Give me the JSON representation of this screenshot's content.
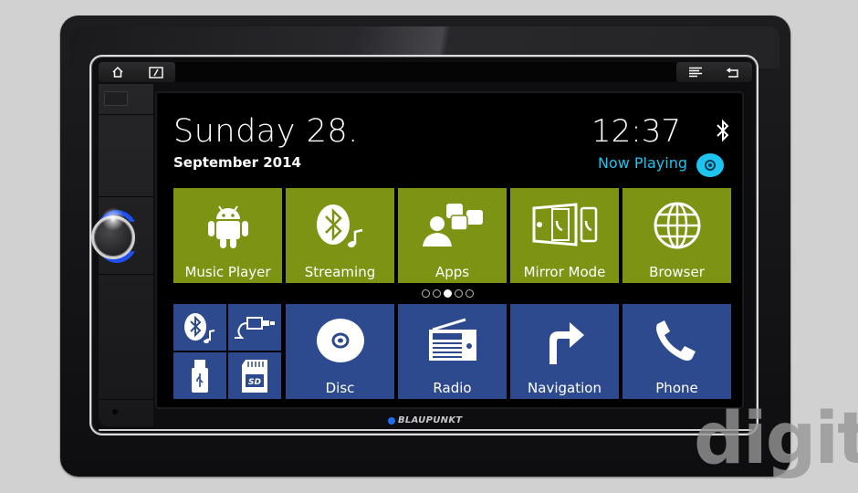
{
  "device": {
    "brand": "BLAUPUNKT",
    "hardware_buttons_left": [
      {
        "name": "home",
        "icon": "home-icon",
        "glyph": "⌂"
      },
      {
        "name": "screen",
        "icon": "screen-toggle-icon",
        "glyph": "◩"
      }
    ],
    "hardware_buttons_right": [
      {
        "name": "menu",
        "icon": "menu-lines-icon",
        "glyph": "≣"
      },
      {
        "name": "back",
        "icon": "back-arrow-icon",
        "glyph": "↵"
      }
    ]
  },
  "header": {
    "day": "Sunday 28.",
    "month_year": "September 2014",
    "time": "12:37",
    "now_playing_label": "Now Playing"
  },
  "tiles_top": [
    {
      "label": "Music Player",
      "icon": "android-icon"
    },
    {
      "label": "Streaming",
      "icon": "bluetooth-audio-icon"
    },
    {
      "label": "Apps",
      "icon": "apps-person-icon"
    },
    {
      "label": "Mirror Mode",
      "icon": "mirror-mode-icon"
    },
    {
      "label": "Browser",
      "icon": "globe-icon"
    }
  ],
  "tiles_mini": [
    {
      "name": "bluetooth-audio",
      "icon": "bluetooth-audio-icon"
    },
    {
      "name": "aux-input",
      "icon": "aux-cable-icon"
    },
    {
      "name": "usb",
      "icon": "usb-icon"
    },
    {
      "name": "sd-card",
      "icon": "sd-card-icon"
    }
  ],
  "tiles_bottom": [
    {
      "label": "Disc",
      "icon": "disc-icon"
    },
    {
      "label": "Radio",
      "icon": "radio-icon"
    },
    {
      "label": "Navigation",
      "icon": "turn-right-arrow-icon"
    },
    {
      "label": "Phone",
      "icon": "phone-handset-icon"
    }
  ],
  "pager": {
    "pages": 5,
    "active_page": 3
  },
  "colors": {
    "green_tile": "#7c9314",
    "blue_tile": "#2e4a8e",
    "accent_cyan": "#1ec4f0",
    "background": "#000000"
  },
  "watermark": "digit"
}
